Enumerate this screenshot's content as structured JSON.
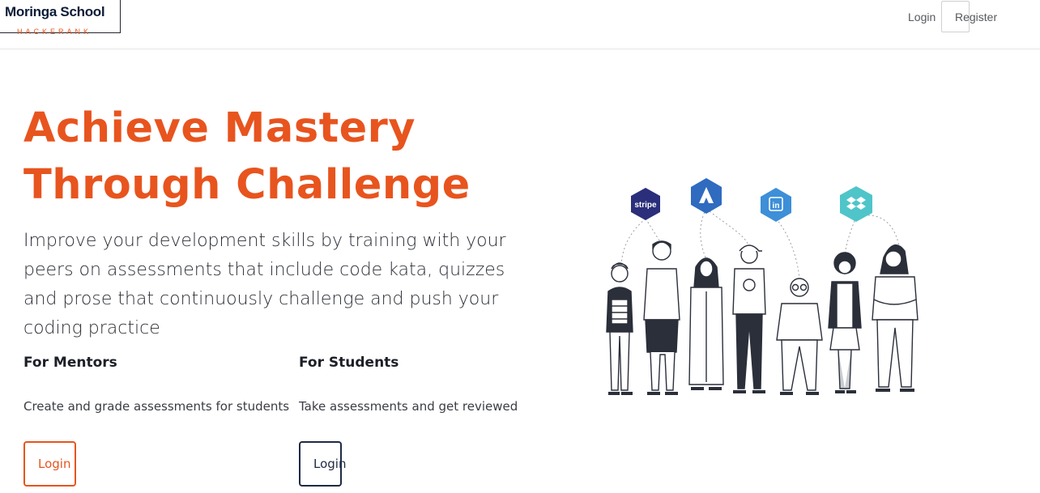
{
  "brand": {
    "name": "Moringa School",
    "tagline": "HACKERANK",
    "accent_color": "#e8541e",
    "navy_color": "#1d2a44"
  },
  "nav": {
    "login_label": "Login",
    "register_label": "Register"
  },
  "hero": {
    "title_line1": "Achieve Mastery",
    "title_line2": "Through Challenge",
    "subtitle": "Improve your development skills by training with your peers on assessments that include code kata, quizzes and prose that continuously challenge and push your coding practice"
  },
  "mentors": {
    "title": "For Mentors",
    "description": "Create and grade assessments for students",
    "button_label": "Login"
  },
  "students": {
    "title": "For Students",
    "description": "Take assessments and get reviewed",
    "button_label": "Login"
  },
  "illustration": {
    "logos": [
      {
        "name": "stripe-logo",
        "text": "stripe",
        "color": "#2b2e7a"
      },
      {
        "name": "atlassian-logo",
        "text": "",
        "color": "#2f6bbf"
      },
      {
        "name": "linkedin-logo",
        "text": "in",
        "color": "#3d8fd8"
      },
      {
        "name": "dropbox-logo",
        "text": "",
        "color": "#4fc5c9"
      }
    ]
  }
}
